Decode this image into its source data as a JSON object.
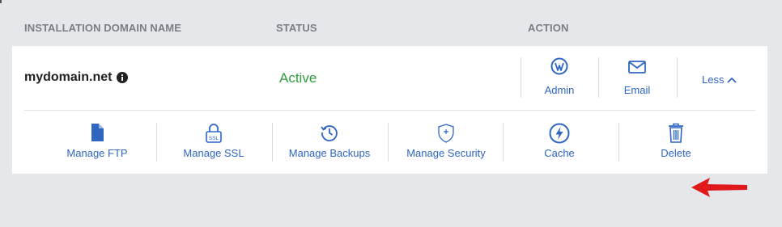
{
  "table_headers": {
    "domain": "INSTALLATION DOMAIN NAME",
    "status": "STATUS",
    "action": "ACTION"
  },
  "row": {
    "domain": "mydomain.net",
    "status": "Active",
    "actions": {
      "admin": "Admin",
      "email": "Email",
      "less": "Less"
    }
  },
  "tools": {
    "manage_ftp": "Manage FTP",
    "manage_ssl": "Manage SSL",
    "manage_backups": "Manage Backups",
    "manage_security": "Manage Security",
    "cache": "Cache",
    "delete": "Delete"
  },
  "icons": {
    "info": "info-icon",
    "wordpress": "wordpress-icon",
    "email": "envelope-icon",
    "less": "chevron-up-icon",
    "ftp": "file-icon",
    "ssl": "padlock-ssl-icon",
    "backups": "history-clock-icon",
    "security": "shield-plus-icon",
    "cache": "bolt-circle-icon",
    "delete": "trash-icon",
    "annotation": "red-arrow-icon"
  },
  "colors": {
    "page_bg": "#e6e7ea",
    "card_bg": "#ffffff",
    "accent": "#2f66c2",
    "status_active": "#2e9d3d",
    "header_text": "#7b7e85",
    "annotation": "#e0191d"
  }
}
